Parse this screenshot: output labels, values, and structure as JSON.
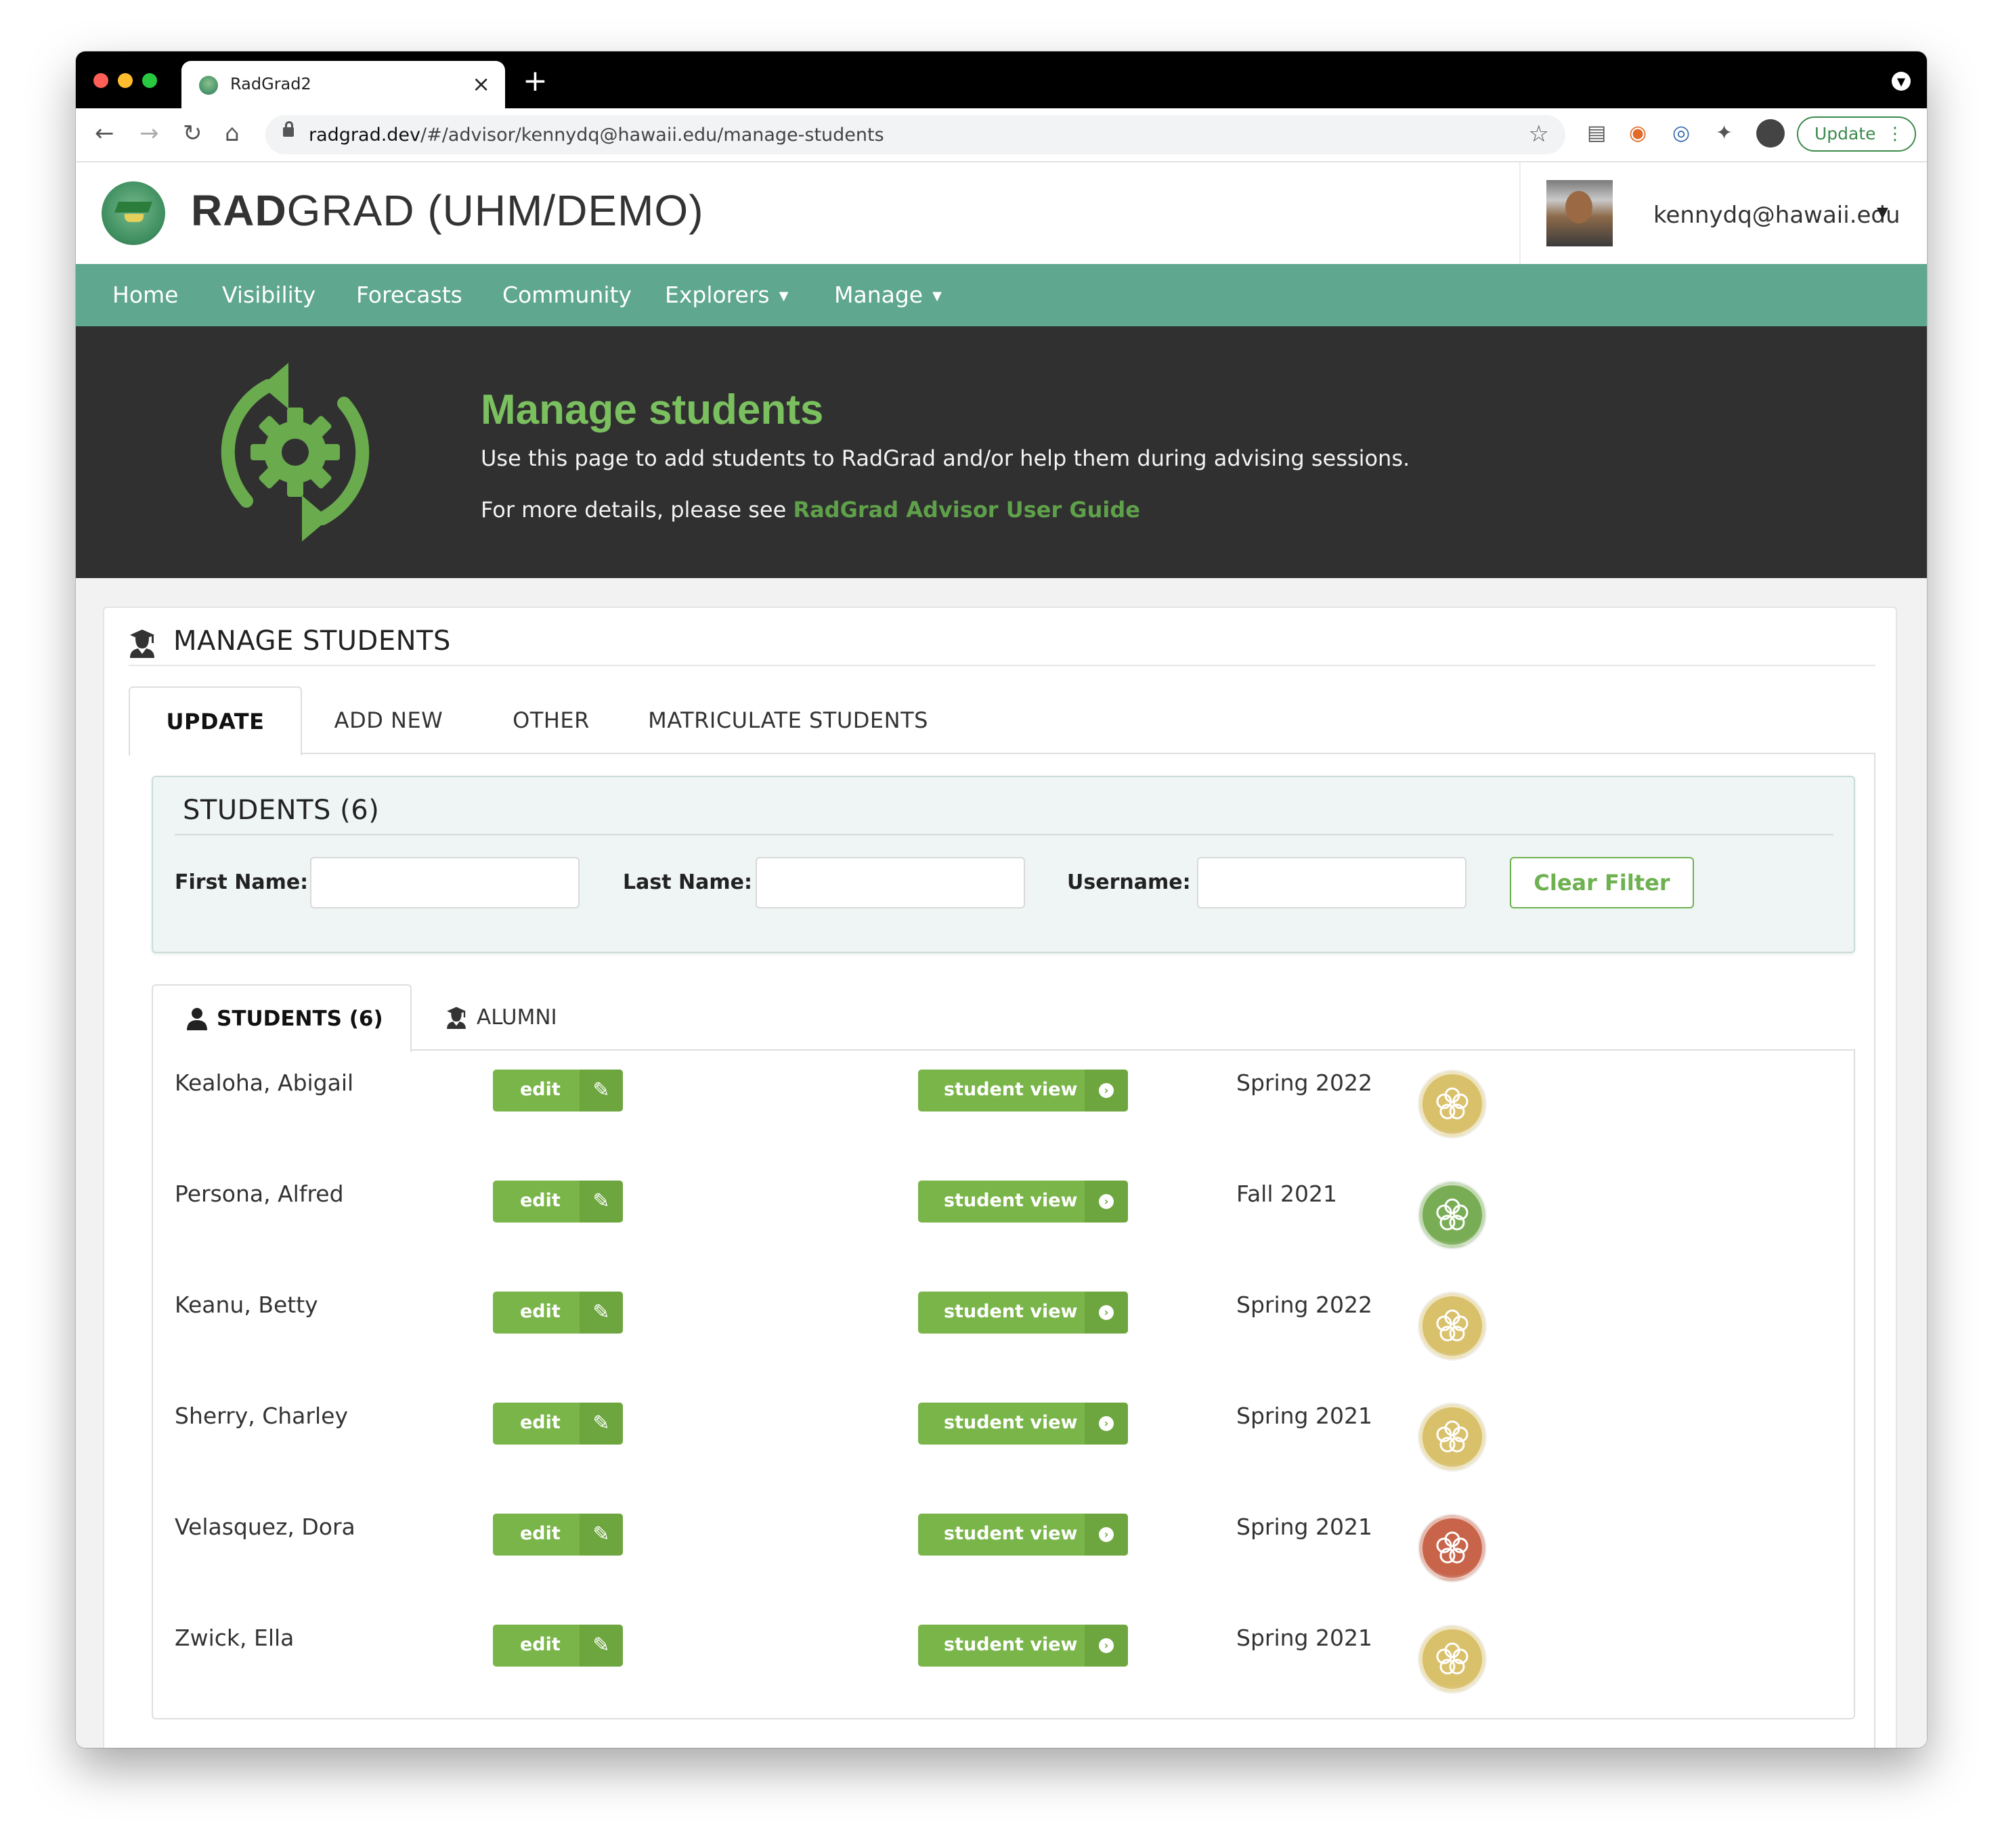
{
  "browser": {
    "tab_title": "RadGrad2",
    "new_tab_glyph": "+",
    "close_glyph": "×",
    "url_host": "radgrad.dev",
    "url_path": "/#/advisor/kennydq@hawaii.edu/manage-students",
    "update_label": "Update"
  },
  "header": {
    "title_bold": "RAD",
    "title_rest": "GRAD (UHM/DEMO)",
    "user": "kennydq@hawaii.edu"
  },
  "nav": {
    "items": [
      "Home",
      "Visibility",
      "Forecasts",
      "Community",
      "Explorers",
      "Manage"
    ]
  },
  "hero": {
    "title": "Manage students",
    "line1": "Use this page to add students to RadGrad and/or help them during advising sessions.",
    "line2_prefix": "For more details, please see ",
    "line2_link": "RadGrad Advisor User Guide"
  },
  "card": {
    "title": "MANAGE STUDENTS",
    "tabs": [
      "UPDATE",
      "ADD NEW",
      "OTHER",
      "MATRICULATE STUDENTS"
    ]
  },
  "filter": {
    "title": "STUDENTS (6)",
    "first_name_label": "First Name:",
    "first_name_value": "",
    "last_name_label": "Last Name:",
    "last_name_value": "",
    "username_label": "Username:",
    "username_value": "",
    "clear_label": "Clear Filter"
  },
  "list_tabs": {
    "students": "STUDENTS (6)",
    "alumni": "ALUMNI"
  },
  "buttons": {
    "edit": "edit",
    "student_view": "student view"
  },
  "students": [
    {
      "name": "Kealoha, Abigail",
      "term": "Spring 2022",
      "badge_color": "#d9c06a"
    },
    {
      "name": "Persona, Alfred",
      "term": "Fall 2021",
      "badge_color": "#79ad55"
    },
    {
      "name": "Keanu, Betty",
      "term": "Spring 2022",
      "badge_color": "#d9c06a"
    },
    {
      "name": "Sherry, Charley",
      "term": "Spring 2021",
      "badge_color": "#d9c06a"
    },
    {
      "name": "Velasquez, Dora",
      "term": "Spring 2021",
      "badge_color": "#c8644a"
    },
    {
      "name": "Zwick, Ella",
      "term": "Spring 2021",
      "badge_color": "#d9c06a"
    }
  ],
  "colors": {
    "nav": "#5fa78f",
    "hero_bg": "#303030",
    "accent_green": "#7ab54a",
    "hero_title": "#7bc05f"
  }
}
